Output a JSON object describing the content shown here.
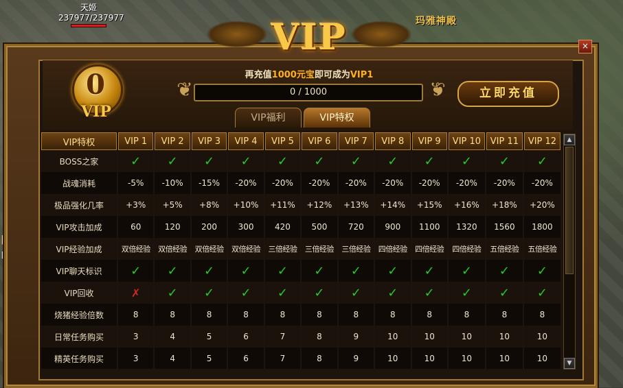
{
  "player": {
    "name": "天姬",
    "hp": "237977/237977"
  },
  "map_name": "玛雅神殿",
  "side": {
    "text1": "回收",
    "text2": "回收"
  },
  "dialog": {
    "title": "VIP",
    "close": "×",
    "badge": {
      "level": "0",
      "label": "VIP"
    },
    "recharge": {
      "prefix": "再充值",
      "amount": "1000元宝",
      "middle": "即可成为",
      "target": "VIP1"
    },
    "progress": {
      "text": "0 / 1000",
      "value": 0,
      "max": 1000
    },
    "recharge_button": "立即充值",
    "tabs": [
      {
        "label": "VIP福利",
        "active": false
      },
      {
        "label": "VIP特权",
        "active": true
      }
    ],
    "table": {
      "header_label": "VIP特权",
      "columns": [
        "VIP 1",
        "VIP 2",
        "VIP 3",
        "VIP 4",
        "VIP 5",
        "VIP 6",
        "VIP 7",
        "VIP 8",
        "VIP 9",
        "VIP 10",
        "VIP 11",
        "VIP 12"
      ],
      "rows": [
        {
          "label": "BOSS之家",
          "cells": [
            "✓",
            "✓",
            "✓",
            "✓",
            "✓",
            "✓",
            "✓",
            "✓",
            "✓",
            "✓",
            "✓",
            "✓"
          ]
        },
        {
          "label": "战魂消耗",
          "cells": [
            "-5%",
            "-10%",
            "-15%",
            "-20%",
            "-20%",
            "-20%",
            "-20%",
            "-20%",
            "-20%",
            "-20%",
            "-20%",
            "-20%"
          ]
        },
        {
          "label": "极品强化几率",
          "cells": [
            "+3%",
            "+5%",
            "+8%",
            "+10%",
            "+11%",
            "+12%",
            "+13%",
            "+14%",
            "+15%",
            "+16%",
            "+18%",
            "+20%"
          ]
        },
        {
          "label": "VIP攻击加成",
          "cells": [
            "60",
            "120",
            "200",
            "300",
            "420",
            "500",
            "720",
            "900",
            "1100",
            "1320",
            "1560",
            "1800"
          ]
        },
        {
          "label": "VIP经验加成",
          "cells": [
            "双倍经验",
            "双倍经验",
            "双倍经验",
            "双倍经验",
            "三倍经验",
            "三倍经验",
            "三倍经验",
            "四倍经验",
            "四倍经验",
            "四倍经验",
            "五倍经验",
            "五倍经验"
          ]
        },
        {
          "label": "VIP聊天标识",
          "cells": [
            "✓",
            "✓",
            "✓",
            "✓",
            "✓",
            "✓",
            "✓",
            "✓",
            "✓",
            "✓",
            "✓",
            "✓"
          ]
        },
        {
          "label": "VIP回收",
          "cells": [
            "✗",
            "✓",
            "✓",
            "✓",
            "✓",
            "✓",
            "✓",
            "✓",
            "✓",
            "✓",
            "✓",
            "✓"
          ]
        },
        {
          "label": "烧猪经验倍数",
          "cells": [
            "8",
            "8",
            "8",
            "8",
            "8",
            "8",
            "8",
            "8",
            "8",
            "8",
            "8",
            "8"
          ]
        },
        {
          "label": "日常任务购买",
          "cells": [
            "3",
            "4",
            "5",
            "6",
            "7",
            "8",
            "9",
            "10",
            "10",
            "10",
            "10",
            "10"
          ]
        },
        {
          "label": "精英任务购买",
          "cells": [
            "3",
            "4",
            "5",
            "6",
            "7",
            "8",
            "9",
            "10",
            "10",
            "10",
            "10",
            "10"
          ]
        }
      ]
    },
    "scrollbar": {
      "up": "▲",
      "down": "▼"
    }
  },
  "colors": {
    "gold": "#f7c946",
    "check": "#28c828",
    "cross": "#d22a1c",
    "accent": "#ffb020"
  }
}
